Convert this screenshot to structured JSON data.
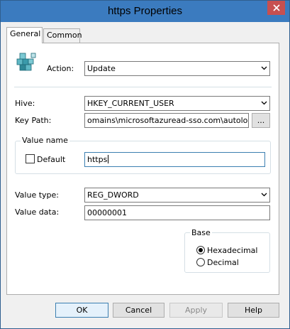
{
  "window": {
    "title": "https Properties",
    "close_glyph": "✕",
    "titlebar_color": "#3b7bbf",
    "close_color": "#c75050"
  },
  "tabs": [
    {
      "label": "General",
      "active": true
    },
    {
      "label": "Common",
      "active": false
    }
  ],
  "general": {
    "action_label": "Action:",
    "action_value": "Update",
    "hive_label": "Hive:",
    "hive_value": "HKEY_CURRENT_USER",
    "keypath_label": "Key Path:",
    "keypath_value": "omains\\microsoftazuread-sso.com\\autologon",
    "browse_label": "...",
    "value_name_group": "Value name",
    "default_label": "Default",
    "default_checked": false,
    "value_name": "https",
    "value_type_label": "Value type:",
    "value_type": "REG_DWORD",
    "value_data_label": "Value data:",
    "value_data": "00000001",
    "base_group": "Base",
    "base_options": [
      {
        "label": "Hexadecimal",
        "checked": true
      },
      {
        "label": "Decimal",
        "checked": false
      }
    ]
  },
  "buttons": {
    "ok": "OK",
    "cancel": "Cancel",
    "apply": "Apply",
    "help": "Help"
  },
  "icons": {
    "registry": "registry-cubes-icon",
    "dropdown": "chevron-down-icon",
    "close": "close-icon"
  }
}
